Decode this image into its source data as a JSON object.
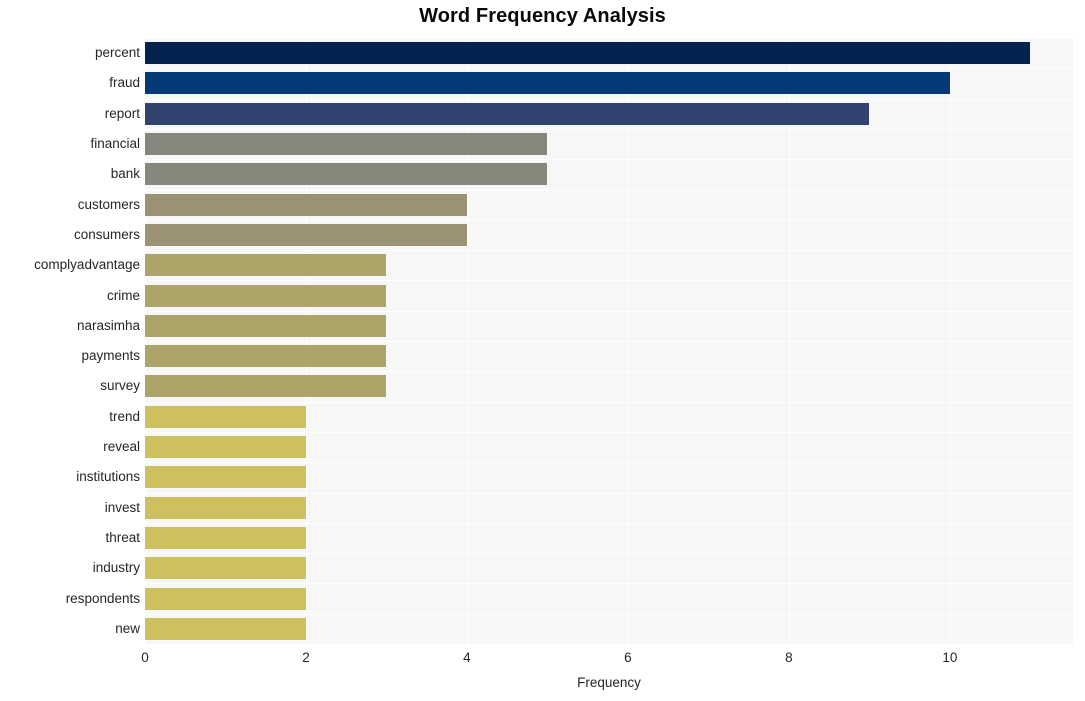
{
  "chart_data": {
    "type": "bar",
    "orientation": "horizontal",
    "title": "Word Frequency Analysis",
    "xlabel": "Frequency",
    "ylabel": "",
    "xlim": [
      0,
      11.53
    ],
    "xticks": [
      0,
      2,
      4,
      6,
      8,
      10
    ],
    "xtick_labels": [
      "0",
      "2",
      "4",
      "6",
      "8",
      "10"
    ],
    "grid": true,
    "legend": null,
    "categories": [
      "percent",
      "fraud",
      "report",
      "financial",
      "bank",
      "customers",
      "consumers",
      "complyadvantage",
      "crime",
      "narasimha",
      "payments",
      "survey",
      "trend",
      "reveal",
      "institutions",
      "invest",
      "threat",
      "industry",
      "respondents",
      "new"
    ],
    "values": [
      11,
      10,
      9,
      5,
      5,
      4,
      4,
      3,
      3,
      3,
      3,
      3,
      2,
      2,
      2,
      2,
      2,
      2,
      2,
      2
    ],
    "colors": [
      "#04244f",
      "#043876",
      "#32436f",
      "#86867a",
      "#87877b",
      "#9b9274",
      "#9c9374",
      "#ada469",
      "#ada469",
      "#ada469",
      "#ada469",
      "#ada469",
      "#cdc05f",
      "#cdc05f",
      "#cdc05f",
      "#cdc05f",
      "#cdc05f",
      "#cdc05f",
      "#cdc05f",
      "#cdc05f"
    ],
    "plot_background": "#f7f7f7",
    "gridline_color": "#ffffff",
    "figure_background": "#ffffff"
  }
}
